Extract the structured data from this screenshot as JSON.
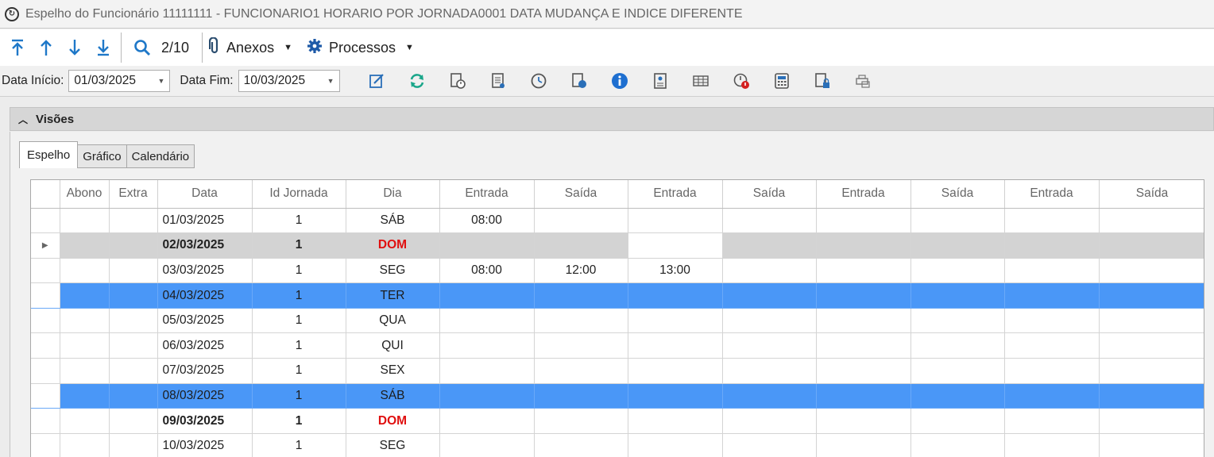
{
  "window": {
    "title": "Espelho do Funcionário 11111111 - FUNCIONARIO1 HORARIO POR JORNADA0001 DATA MUDANÇA E INDICE DIFERENTE"
  },
  "nav": {
    "record_counter": "2/10",
    "anexos_label": "Anexos",
    "processos_label": "Processos"
  },
  "filters": {
    "data_inicio_label": "Data Início:",
    "data_inicio_value": "01/03/2025",
    "data_fim_label": "Data Fim:",
    "data_fim_value": "10/03/2025"
  },
  "toolbar_icons": [
    "edit-icon",
    "refresh-icon",
    "document-clock-icon",
    "document-list-icon",
    "clock-icon",
    "document-info-icon",
    "info-icon",
    "badge-icon",
    "spreadsheet-icon",
    "clock-alert-icon",
    "calculator-icon",
    "document-lock-icon",
    "print-icon"
  ],
  "visoes": {
    "title": "Visões"
  },
  "tabs": [
    "Espelho",
    "Gráfico",
    "Calendário"
  ],
  "grid": {
    "columns": [
      "",
      "Abono",
      "Extra",
      "Data",
      "Id Jornada",
      "Dia",
      "Entrada",
      "Saída",
      "Entrada",
      "Saída",
      "Entrada",
      "Saída",
      "Entrada",
      "Saída"
    ],
    "rows": [
      {
        "data": "01/03/2025",
        "id": "1",
        "dia": "SÁB",
        "e1": "08:00",
        "s1": "",
        "e2": "",
        "state": "normal"
      },
      {
        "data": "02/03/2025",
        "id": "1",
        "dia": "DOM",
        "e1": "",
        "s1": "",
        "e2": "",
        "state": "current"
      },
      {
        "data": "03/03/2025",
        "id": "1",
        "dia": "SEG",
        "e1": "08:00",
        "s1": "12:00",
        "e2": "13:00",
        "state": "normal"
      },
      {
        "data": "04/03/2025",
        "id": "1",
        "dia": "TER",
        "e1": "",
        "s1": "",
        "e2": "",
        "state": "selected"
      },
      {
        "data": "05/03/2025",
        "id": "1",
        "dia": "QUA",
        "e1": "",
        "s1": "",
        "e2": "",
        "state": "normal"
      },
      {
        "data": "06/03/2025",
        "id": "1",
        "dia": "QUI",
        "e1": "",
        "s1": "",
        "e2": "",
        "state": "normal"
      },
      {
        "data": "07/03/2025",
        "id": "1",
        "dia": "SEX",
        "e1": "",
        "s1": "",
        "e2": "",
        "state": "normal"
      },
      {
        "data": "08/03/2025",
        "id": "1",
        "dia": "SÁB",
        "e1": "",
        "s1": "",
        "e2": "",
        "state": "selected"
      },
      {
        "data": "09/03/2025",
        "id": "1",
        "dia": "DOM",
        "e1": "",
        "s1": "",
        "e2": "",
        "state": "bold"
      },
      {
        "data": "10/03/2025",
        "id": "1",
        "dia": "SEG",
        "e1": "",
        "s1": "",
        "e2": "",
        "state": "normal"
      }
    ]
  }
}
